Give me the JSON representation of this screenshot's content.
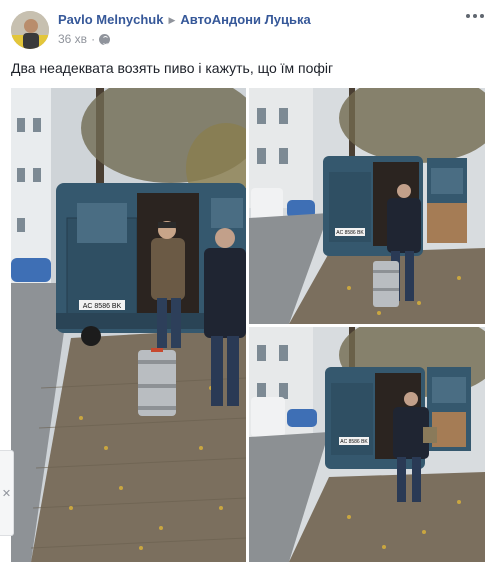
{
  "post": {
    "author": "Pavlo Melnychuk",
    "group": "АвтоАндони Луцька",
    "timestamp": "36 хв",
    "separator": "·",
    "audience_icon": "globe-icon",
    "text": "Два неадеквата возять пиво і кажуть, що їм пофіг",
    "menu_icon": "more-options-icon"
  },
  "photos": [
    {
      "position": "main-left",
      "plate": "AC 8586 BK"
    },
    {
      "position": "top-right",
      "plate": "AC 8586 BK"
    },
    {
      "position": "bottom-right",
      "plate": "AC 8586 BK"
    }
  ],
  "colors": {
    "link": "#365899",
    "meta": "#90949c",
    "van": "#35586e"
  },
  "side_handle": {
    "icon": "close-icon",
    "glyph": "✕"
  }
}
